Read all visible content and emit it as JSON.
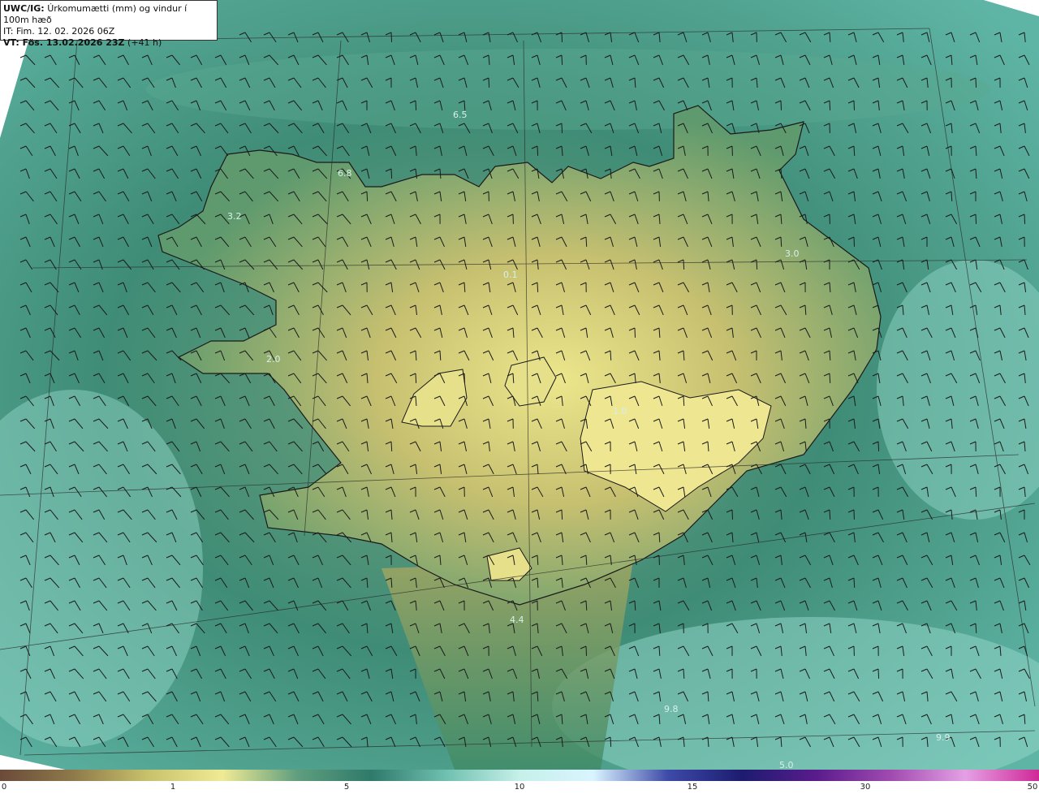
{
  "header": {
    "model": "UWC/IG:",
    "title": "Úrkomumætti (mm) og vindur í 100m hæð",
    "issue_time": "IT: Fim. 12. 02. 2026 06Z",
    "valid_time": "VT: Fös. 13.02.2026 23Z",
    "lead": "(+41 h)"
  },
  "map_labels": [
    "6.5",
    "6.8",
    "3.2",
    "0.1",
    "3.0",
    "2.0",
    "1.0",
    "4.4",
    "5.0",
    "9.9",
    "9.8"
  ],
  "colorbar": {
    "ticks": [
      "0",
      "1",
      "5",
      "10",
      "15",
      "30",
      "50"
    ],
    "colors": [
      "#6b4a3a",
      "#8f7a4a",
      "#c9c26c",
      "#f0ea94",
      "#5f9e7e",
      "#2f7a6a",
      "#6fc0b0",
      "#c6f0ea",
      "#d9f4ff",
      "#3d4aa8",
      "#1c1c70",
      "#5a1c8c",
      "#a04ab0",
      "#e4a0e4",
      "#d02898"
    ]
  }
}
